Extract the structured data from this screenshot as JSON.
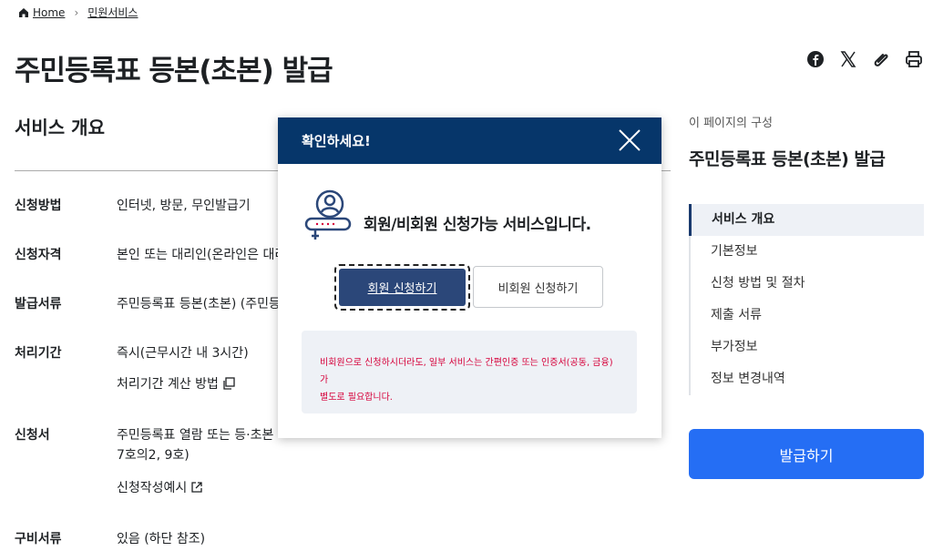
{
  "breadcrumb": {
    "home": "Home",
    "current": "민원서비스"
  },
  "page": {
    "title": "주민등록표 등본(초본) 발급"
  },
  "share": {
    "icons": [
      "facebook-icon",
      "x-icon",
      "link-icon",
      "print-icon"
    ]
  },
  "overview": {
    "title": "서비스 개요",
    "rows": [
      {
        "label": "신청방법",
        "value": "인터넷, 방문, 무인발급기"
      },
      {
        "label": "신청자격",
        "value": "본인 또는 대리인(온라인은 대리"
      },
      {
        "label": "발급서류",
        "value": "주민등록표 등본(초본) (주민등"
      },
      {
        "label": "처리기간",
        "value": "즉시(근무시간 내 3시간)",
        "link": "처리기간 계산 방법"
      },
      {
        "label": "신청서",
        "value": "주민등록표 열람 또는 등·초본",
        "value2": "7호의2, 9호)",
        "link": "신청작성예시"
      },
      {
        "label": "구비서류",
        "value": "있음 (하단 참조)"
      }
    ]
  },
  "toc": {
    "title": "이 페이지의 구성",
    "heading": "주민등록표 등본(초본) 발급",
    "items": [
      "서비스 개요",
      "기본정보",
      "신청 방법 및 절차",
      "제출 서류",
      "부가정보",
      "정보 변경내역"
    ],
    "active_index": 0,
    "action": "발급하기"
  },
  "modal": {
    "title": "확인하세요!",
    "message": "회원/비회원 신청가능 서비스입니다.",
    "member_button": "회원 신청하기",
    "guest_button": "비회원 신청하기",
    "notice_line1": "비회원으로 신청하시더라도, 일부 서비스는 간편인증 또는 인증서(공동, 금융)가",
    "notice_line2": "별도로 필요합니다."
  },
  "colors": {
    "primary": "#256ef4",
    "header": "#06366a",
    "member_button": "#2b4779",
    "notice_text": "#d6003a"
  }
}
